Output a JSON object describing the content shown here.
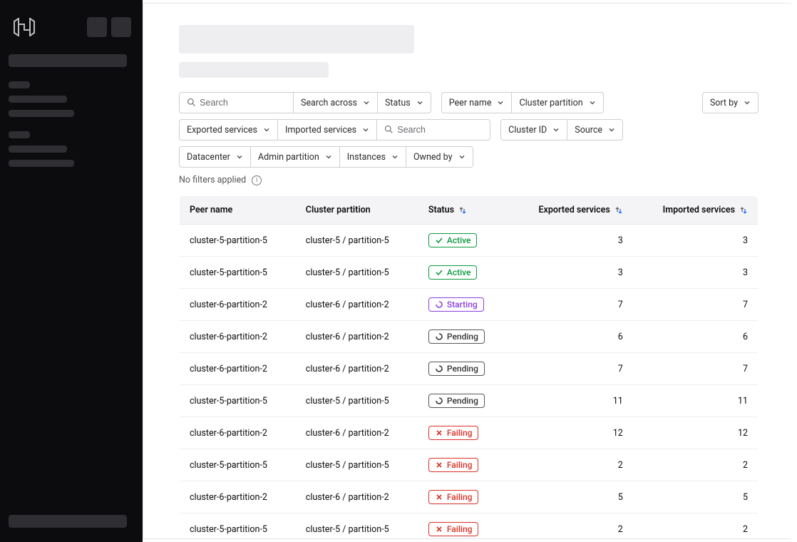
{
  "filters": {
    "search_placeholder": "Search",
    "search_across": "Search across",
    "status": "Status",
    "peer_name": "Peer name",
    "cluster_partition": "Cluster partition",
    "sort_by": "Sort by",
    "exported_services": "Exported services",
    "imported_services": "Imported services",
    "search2_placeholder": "Search",
    "cluster_id": "Cluster ID",
    "source": "Source",
    "datacenter": "Datacenter",
    "admin_partition": "Admin partition",
    "instances": "Instances",
    "owned_by": "Owned by",
    "no_filters": "No filters applied"
  },
  "columns": {
    "peer_name": "Peer name",
    "cluster_partition": "Cluster partition",
    "status": "Status",
    "exported_services": "Exported services",
    "imported_services": "Imported services"
  },
  "status_labels": {
    "active": "Active",
    "starting": "Starting",
    "pending": "Pending",
    "failing": "Failing"
  },
  "rows": [
    {
      "peer": "cluster-5-partition-5",
      "partition": "cluster-5 / partition-5",
      "status": "active",
      "exp": "3",
      "imp": "3"
    },
    {
      "peer": "cluster-5-partition-5",
      "partition": "cluster-5 / partition-5",
      "status": "active",
      "exp": "3",
      "imp": "3"
    },
    {
      "peer": "cluster-6-partition-2",
      "partition": "cluster-6 / partition-2",
      "status": "starting",
      "exp": "7",
      "imp": "7"
    },
    {
      "peer": "cluster-6-partition-2",
      "partition": "cluster-6 / partition-2",
      "status": "pending",
      "exp": "6",
      "imp": "6"
    },
    {
      "peer": "cluster-6-partition-2",
      "partition": "cluster-6 / partition-2",
      "status": "pending",
      "exp": "7",
      "imp": "7"
    },
    {
      "peer": "cluster-5-partition-5",
      "partition": "cluster-5 / partition-5",
      "status": "pending",
      "exp": "11",
      "imp": "11"
    },
    {
      "peer": "cluster-6-partition-2",
      "partition": "cluster-6 / partition-2",
      "status": "failing",
      "exp": "12",
      "imp": "12"
    },
    {
      "peer": "cluster-5-partition-5",
      "partition": "cluster-5 / partition-5",
      "status": "failing",
      "exp": "2",
      "imp": "2"
    },
    {
      "peer": "cluster-6-partition-2",
      "partition": "cluster-6 / partition-2",
      "status": "failing",
      "exp": "5",
      "imp": "5"
    },
    {
      "peer": "cluster-5-partition-5",
      "partition": "cluster-5 / partition-5",
      "status": "failing",
      "exp": "2",
      "imp": "2"
    }
  ]
}
